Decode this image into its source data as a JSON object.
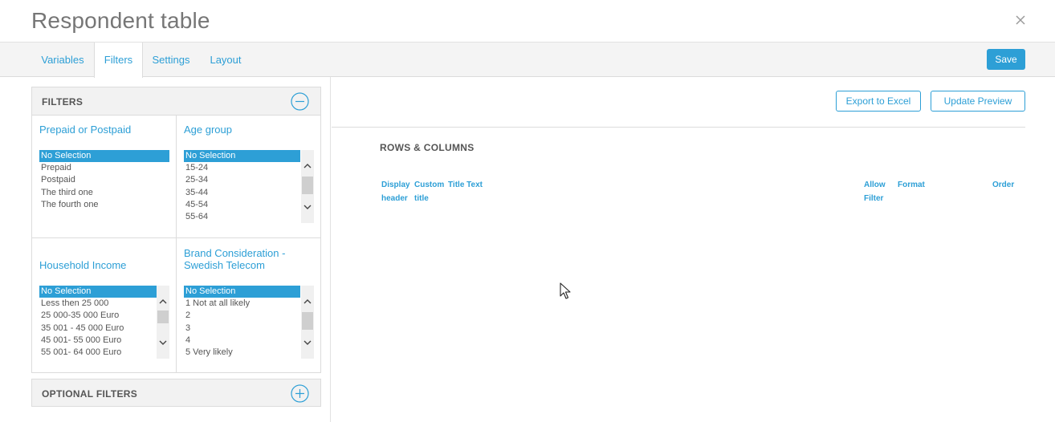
{
  "window": {
    "title": "Respondent table",
    "close_icon": "close-icon"
  },
  "tabs": [
    {
      "label": "Variables",
      "active": false
    },
    {
      "label": "Filters",
      "active": true
    },
    {
      "label": "Settings",
      "active": false
    },
    {
      "label": "Layout",
      "active": false
    }
  ],
  "toolbar": {
    "save_label": "Save"
  },
  "filters": {
    "heading": "FILTERS",
    "collapse_icon": "minus-circle-icon",
    "cells": [
      {
        "title": "Prepaid or Postpaid",
        "options": [
          "No Selection",
          "Prepaid",
          "Postpaid",
          "The third one",
          "The fourth one"
        ],
        "selected": "No Selection",
        "has_scrollbar": false
      },
      {
        "title": "Age group",
        "options": [
          "No Selection",
          "15-24",
          "25-34",
          "35-44",
          "45-54",
          "55-64"
        ],
        "selected": "No Selection",
        "has_scrollbar": true
      },
      {
        "title": "Household Income",
        "options": [
          "No Selection",
          "Less then 25 000",
          "25 000-35 000 Euro",
          "35 001 - 45 000 Euro",
          "45 001- 55 000 Euro",
          "55 001- 64 000 Euro"
        ],
        "selected": "No Selection",
        "has_scrollbar": true
      },
      {
        "title": "Brand Consideration - Swedish Telecom",
        "options": [
          "No Selection",
          "1 Not at all likely",
          "2",
          "3",
          "4",
          "5 Very likely"
        ],
        "selected": "No Selection",
        "has_scrollbar": true
      }
    ]
  },
  "optional_filters": {
    "heading": "OPTIONAL FILTERS",
    "expand_icon": "plus-circle-icon"
  },
  "preview": {
    "export_label": "Export to Excel",
    "update_label": "Update Preview",
    "section_title": "ROWS & COLUMNS",
    "columns": {
      "display_header": "Display header",
      "custom_title": "Custom title",
      "title_text": "Title Text",
      "allow_filter": "Allow Filter",
      "format": "Format",
      "order": "Order"
    }
  },
  "colors": {
    "accent": "#2d9fd6",
    "header_bg": "#f2f2f2",
    "tabbar_bg": "#f4f4f4",
    "border": "#dcdcdc"
  }
}
